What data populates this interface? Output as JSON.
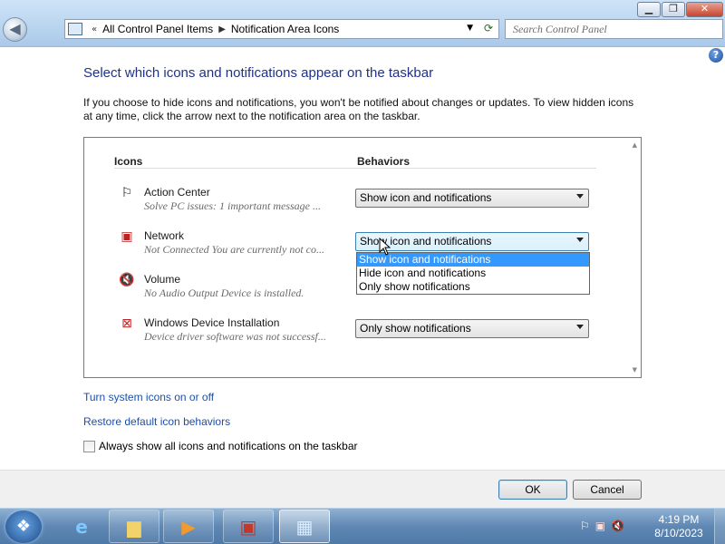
{
  "window": {
    "minimize_icon": "minimize-icon",
    "maximize_icon": "maximize-icon",
    "close_icon": "close-icon"
  },
  "address": {
    "crumbs": [
      "All Control Panel Items",
      "Notification Area Icons"
    ],
    "search_placeholder": "Search Control Panel"
  },
  "main": {
    "title": "Select which icons and notifications appear on the taskbar",
    "description": "If you choose to hide icons and notifications, you won't be notified about changes or updates. To view hidden icons at any time, click the arrow next to the notification area on the taskbar.",
    "col_icons": "Icons",
    "col_behaviors": "Behaviors",
    "rows": [
      {
        "name": "Action Center",
        "subtitle": "Solve PC issues: 1 important message ...",
        "behavior": "Show icon and notifications",
        "icon": "flag-icon"
      },
      {
        "name": "Network",
        "subtitle": "Not Connected You are currently not co...",
        "behavior": "Show icon and notifications",
        "icon": "network-icon"
      },
      {
        "name": "Volume",
        "subtitle": "No Audio Output Device is installed.",
        "behavior": "",
        "icon": "volume-icon"
      },
      {
        "name": "Windows Device Installation",
        "subtitle": "Device driver software was not successf...",
        "behavior": "Only show notifications",
        "icon": "device-install-icon"
      }
    ],
    "dropdown_options": [
      "Show icon and notifications",
      "Hide icon and notifications",
      "Only show notifications"
    ],
    "links": {
      "system_icons": "Turn system icons on or off",
      "restore": "Restore default icon behaviors"
    },
    "always_show_label": "Always show all icons and notifications on the taskbar"
  },
  "footer": {
    "ok": "OK",
    "cancel": "Cancel"
  },
  "taskbar": {
    "time": "4:19 PM",
    "date": "8/10/2023"
  }
}
